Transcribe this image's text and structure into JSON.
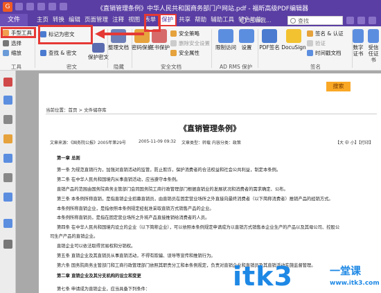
{
  "window": {
    "title": "《直销管理条例》中华人民共和国商务部门户网站.pdf - 福昕高级PDF编辑器",
    "colors": {
      "titlebar": "#5a3ea3",
      "highlight": "#e53935",
      "page_bg": "#a9a9a9",
      "search_button": "#f9a825",
      "watermark": "#1e88e5"
    }
  },
  "menu": {
    "file_label": "文件",
    "tabs": [
      "主页",
      "转换",
      "编辑",
      "页面管理",
      "注释",
      "视图",
      "表单",
      "保护",
      "共享",
      "帮助",
      "辅助工具",
      "特色功能"
    ],
    "active_tab": "保护",
    "tell_me": "告诉我...",
    "search_placeholder": "查找"
  },
  "ribbon": {
    "tools": {
      "hand": "手型工具",
      "select": "选择",
      "zoom": "缩放",
      "group": "工具"
    },
    "secret": {
      "mark_as_secret": "标记为密文",
      "find_replace": "查找 & 密文",
      "apply_secret": "保护密文",
      "group": "密文"
    },
    "hidden": {
      "clean": "整理文档",
      "group": "隐藏"
    },
    "security": {
      "password": "密码保护",
      "certificate": "证书保护",
      "policy": "安全策略",
      "remove": "删除安全设置",
      "properties": "安全属性",
      "group": "安全文档"
    },
    "adrms": {
      "restrict": "限制访问",
      "settings": "设置",
      "group": "AD RMS 保护"
    },
    "sign": {
      "pdf_sign": "PDF签名",
      "docusign": "DocuSign",
      "sign_cert": "签名 & 认证",
      "validate": "验证",
      "timestamp": "时间戳文档",
      "group": "签名"
    },
    "digital_id": {
      "id": "数字证书",
      "trusted": "受信任证书"
    }
  },
  "page": {
    "search_button": "搜索",
    "breadcrumb": "当前位置：首页 > 文件储存库",
    "article_title": "《直销管理条例》",
    "source": "文章来源：《国务院公报》2005年第29号",
    "date": "2005-11-09 09:32",
    "category": "文章类型：转载  内容分类：政策",
    "font_size": "【大 中 小】【打印】",
    "ch1": "第一章 总则",
    "lines": [
      "第一条 为规范直销行为，加强对直销活动的监管，防止欺诈，保护消费者的合法权益和社会公共利益，制定本条例。",
      "第二条 在中华人民共和国境内从事直销活动，应当遵守本条例。",
      "直销产品的范围由国务院商务主管部门会同国务院工商行政管理部门根据直销业的发展状况和消费者的需求确定、公布。",
      "第三条 本条例所称直销，是指直销企业招募直销员，由直销员在固定营业场所之外直接向最终消费者（以下简称消费者）推销产品的经销方式。",
      "本条例所称直销企业，是指依照本条例规定经批准采取直销方式销售产品的企业。",
      "本条例所称直销员，是指在固定营业场所之外将产品直接推销给消费者的人员。"
    ],
    "line7": "第四条 在中华人民共和国境内设立的企业（以下简称企业），可以依照本条例规定申请成为以直销方式销售本企业生产的产品以及其母公司、控股公",
    "line8": "司生产产品的直销企业。",
    "line9": "直销企业可以依法取得贸易权和分销权。",
    "line10": "第五条 直销企业及其直销员从事直销活动，不得有欺骗、误导等宣传和推销行为。",
    "line11": "第六条 国务院商务主管部门和工商行政管理部门依照其职责分工和本条例规定，负责对直销企业和直销员及其直销活动实施监督管理。",
    "ch2": "第二章 直销企业及其分支机构的设立和变更",
    "line12": "第七条 申请成为直销企业，应当具备下列条件："
  },
  "watermark": {
    "text": "itk3",
    "cn": "一堂课",
    "url": "www.itk3.com"
  }
}
